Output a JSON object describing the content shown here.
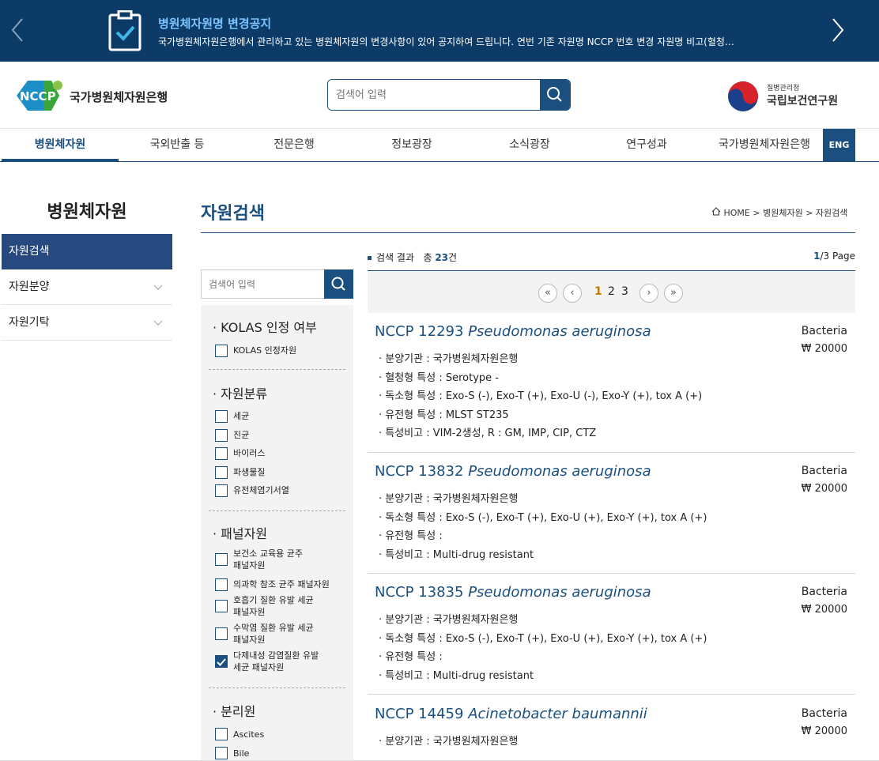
{
  "notice": {
    "title": "병원체자원명 변경공지",
    "text": "국가병원체자원은행에서 관리하고 있는 병원체자원의 변경사항이 있어 공지하여 드립니다. 연번 기존 자원명 NCCP 번호 변경 자원명 비고(혈청…",
    "prev_icon": "chevron-left-icon",
    "next_icon": "chevron-right-icon",
    "icon": "clipboard-check-icon"
  },
  "header": {
    "logo_text": "국가병원체자원은행",
    "search_placeholder": "검색어 입력",
    "kdca_small": "질병관리청",
    "kdca_big": "국립보건연구원"
  },
  "gnb": {
    "items": [
      "병원체자원",
      "국외반출 등",
      "전문은행",
      "정보광장",
      "소식광장",
      "연구성과",
      "국가병원체자원은행"
    ],
    "eng": "ENG"
  },
  "lnb": {
    "title": "병원체자원",
    "items": [
      "자원검색",
      "자원분양",
      "자원기탁"
    ]
  },
  "page": {
    "title": "자원검색",
    "breadcrumb": {
      "home": "HOME",
      "sep1": " > ",
      "level1": "병원체자원",
      "sep2": " > ",
      "level2": "자원검색"
    }
  },
  "filter": {
    "search_placeholder": "검색어 입력",
    "groups": [
      {
        "title": "· KOLAS 인정 여부",
        "options": [
          {
            "label": "KOLAS 인정자원",
            "checked": false
          }
        ]
      },
      {
        "title": "· 자원분류",
        "options": [
          {
            "label": "세균",
            "checked": false
          },
          {
            "label": "진균",
            "checked": false
          },
          {
            "label": "바이러스",
            "checked": false
          },
          {
            "label": "파생물질",
            "checked": false
          },
          {
            "label": "유전체염기서열",
            "checked": false
          }
        ]
      },
      {
        "title": "· 패널자원",
        "options": [
          {
            "label": "보건소 교육용 균주",
            "label2": "패널자원",
            "checked": false
          },
          {
            "label": "의과학 참조 균주 패널자원",
            "checked": false
          },
          {
            "label": "호흡기 질환 유발 세균",
            "label2": "패널자원",
            "checked": false
          },
          {
            "label": "수막염 질환 유발 세균",
            "label2": "패널자원",
            "checked": false
          },
          {
            "label": "다제내성 감염질환 유발",
            "label2": "세균 패널자원",
            "checked": true
          }
        ]
      },
      {
        "title": "· 분리원",
        "options": [
          {
            "label": "Ascites",
            "checked": false
          },
          {
            "label": "Bile",
            "checked": false
          }
        ]
      }
    ]
  },
  "results": {
    "label": "검색 결과",
    "total_prefix": "총",
    "total": "23",
    "total_suffix": "건",
    "page_current": "1",
    "page_total": "/3 Page",
    "pager": {
      "first": "«",
      "prev": "‹",
      "pages": [
        "1",
        "2",
        "3"
      ],
      "next": "›",
      "last": "»"
    },
    "items": [
      {
        "id": "NCCP 12293",
        "species": "Pseudomonas aeruginosa",
        "category": "Bacteria",
        "price": "₩ 20000",
        "lines": [
          "· 분양기관 : 국가병원체자원은행",
          "· 혈청형 특성 : Serotype -",
          "· 독소형 특성 : Exo-S (-), Exo-T (+), Exo-U (-), Exo-Y (+), tox A (+)",
          "· 유전형 특성 : MLST ST235",
          "· 특성비고 : VIM-2생성, R : GM, IMP, CIP, CTZ"
        ]
      },
      {
        "id": "NCCP 13832",
        "species": "Pseudomonas aeruginosa",
        "category": "Bacteria",
        "price": "₩ 20000",
        "lines": [
          "· 분양기관 : 국가병원체자원은행",
          "· 독소형 특성 : Exo-S (-), Exo-T (+), Exo-U (+), Exo-Y (+), tox A (+)",
          "· 유전형 특성 :",
          "· 특성비고 : Multi-drug resistant"
        ]
      },
      {
        "id": "NCCP 13835",
        "species": "Pseudomonas aeruginosa",
        "category": "Bacteria",
        "price": "₩ 20000",
        "lines": [
          "· 분양기관 : 국가병원체자원은행",
          "· 독소형 특성 : Exo-S (-), Exo-T (+), Exo-U (+), Exo-Y (+), tox A (+)",
          "· 유전형 특성 :",
          "· 특성비고 : Multi-drug resistant"
        ]
      },
      {
        "id": "NCCP 14459",
        "species": "Acinetobacter baumannii",
        "category": "Bacteria",
        "price": "₩ 20000",
        "lines": [
          "· 분양기관 : 국가병원체자원은행"
        ]
      }
    ]
  },
  "colors": {
    "primary": "#1b4f80",
    "notice_bg": "#0b3b66",
    "active_nav": "#27497f",
    "page_current": "#c07a00"
  }
}
